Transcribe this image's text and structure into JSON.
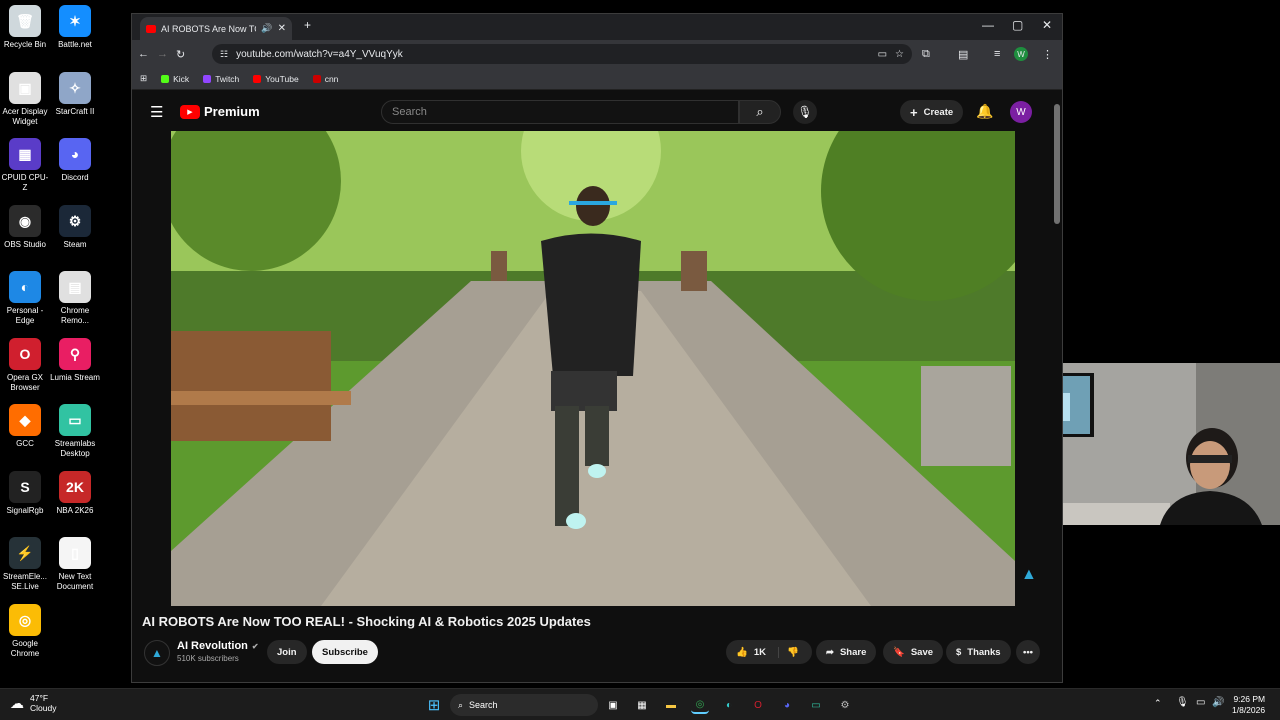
{
  "desktop": {
    "icons": [
      {
        "label": "Recycle Bin",
        "glyph": "🗑",
        "color": "#cfd8dc"
      },
      {
        "label": "Battle.net",
        "glyph": "✶",
        "color": "#148eff"
      },
      {
        "label": "Acer Display Widget",
        "glyph": "▣",
        "color": "#e0e0e0"
      },
      {
        "label": "StarCraft II",
        "glyph": "✧",
        "color": "#8fa6c8"
      },
      {
        "label": "CPUID CPU-Z",
        "glyph": "▦",
        "color": "#5a3cc8"
      },
      {
        "label": "Discord",
        "glyph": "◕",
        "color": "#5865f2"
      },
      {
        "label": "OBS Studio",
        "glyph": "◉",
        "color": "#2b2b2b"
      },
      {
        "label": "Steam",
        "glyph": "⚙",
        "color": "#1b2838"
      },
      {
        "label": "Personal - Edge",
        "glyph": "◐",
        "color": "#1e88e5"
      },
      {
        "label": "Chrome Remo...",
        "glyph": "▤",
        "color": "#e0e0e0"
      },
      {
        "label": "Opera GX Browser",
        "glyph": "O",
        "color": "#d01f2e"
      },
      {
        "label": "Lumia Stream",
        "glyph": "⚲",
        "color": "#e91e63"
      },
      {
        "label": "GCC",
        "glyph": "◆",
        "color": "#ff6d00"
      },
      {
        "label": "Streamlabs Desktop",
        "glyph": "▭",
        "color": "#31c3a2"
      },
      {
        "label": "SignalRgb",
        "glyph": "S",
        "color": "#222"
      },
      {
        "label": "NBA 2K26",
        "glyph": "2K",
        "color": "#c62828"
      },
      {
        "label": "StreamEle... SE.Live",
        "glyph": "⚡",
        "color": "#263238"
      },
      {
        "label": "New Text Document",
        "glyph": "▯",
        "color": "#f5f5f5"
      },
      {
        "label": "Google Chrome",
        "glyph": "◎",
        "color": "#fbbc05"
      }
    ]
  },
  "browser": {
    "tab_title": "AI ROBOTS Are Now TOO R",
    "url": "youtube.com/watch?v=a4Y_VVuqYyk",
    "bookmarks": [
      {
        "label": "Kick",
        "color": "#53fc18"
      },
      {
        "label": "Twitch",
        "color": "#9146ff"
      },
      {
        "label": "YouTube",
        "color": "#ff0000"
      },
      {
        "label": "cnn",
        "color": "#cc0000"
      }
    ],
    "profile_initial": "W"
  },
  "youtube": {
    "logo_text": "Premium",
    "search_placeholder": "Search",
    "create_label": "Create",
    "avatar_initial": "W",
    "video_title": "AI ROBOTS Are Now TOO REAL! - Shocking AI & Robotics 2025 Updates",
    "channel_name": "AI Revolution",
    "subscribers": "510K subscribers",
    "join_label": "Join",
    "subscribe_label": "Subscribe",
    "likes": "1K",
    "share_label": "Share",
    "save_label": "Save",
    "thanks_label": "Thanks"
  },
  "taskbar": {
    "weather_temp": "47°F",
    "weather_desc": "Cloudy",
    "search_label": "Search",
    "time": "9:26 PM",
    "date": "1/8/2026"
  }
}
